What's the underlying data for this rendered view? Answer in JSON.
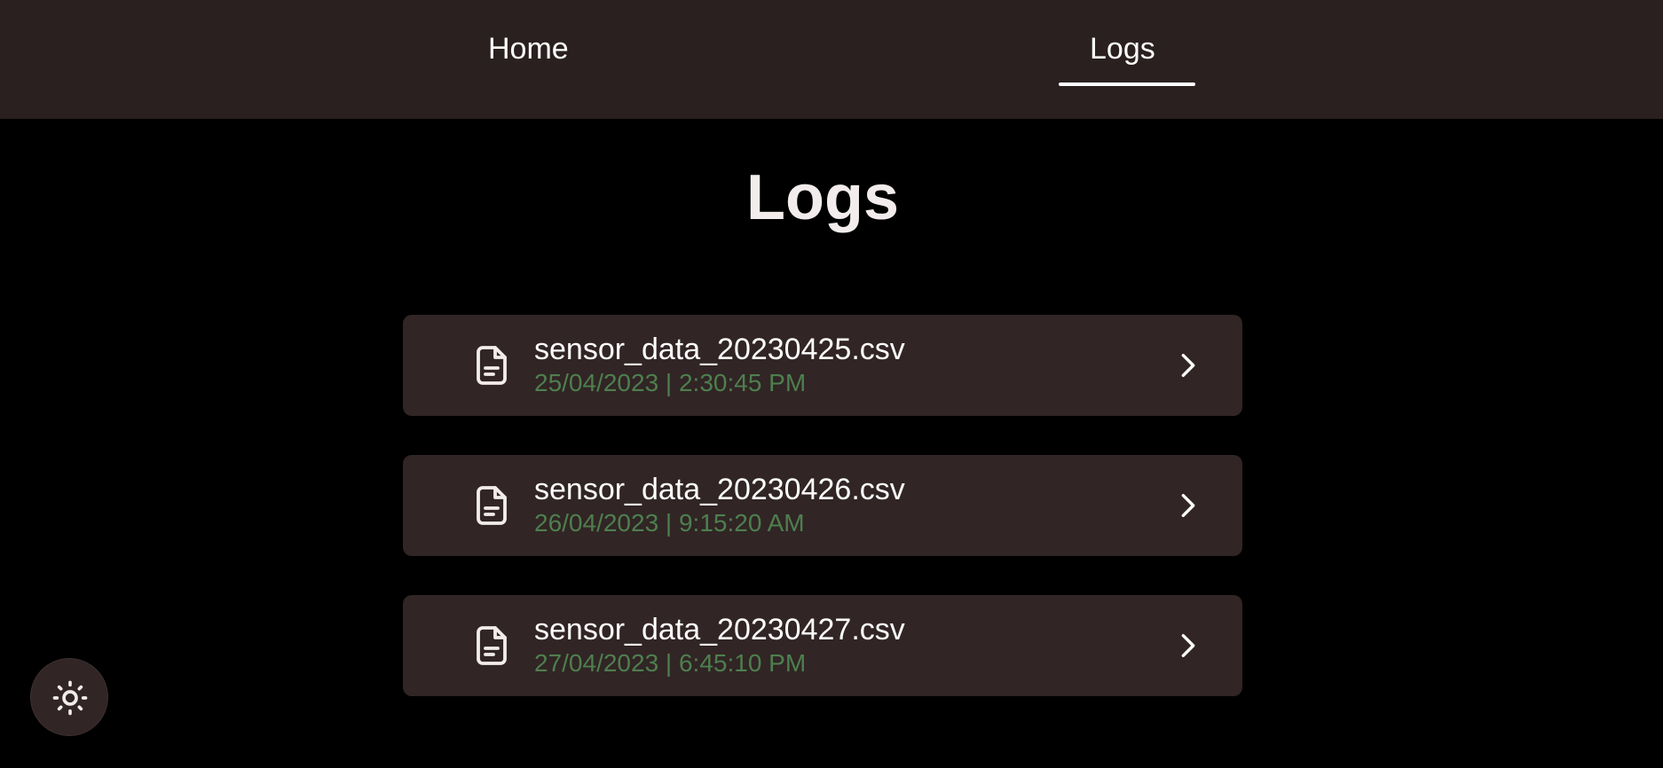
{
  "nav": {
    "items": [
      {
        "label": "Home",
        "active": false
      },
      {
        "label": "Logs",
        "active": true
      }
    ]
  },
  "page": {
    "title": "Logs"
  },
  "logs": [
    {
      "name": "sensor_data_20230425.csv",
      "timestamp": "25/04/2023 | 2:30:45 PM",
      "icon": "file-text-icon"
    },
    {
      "name": "sensor_data_20230426.csv",
      "timestamp": "26/04/2023 | 9:15:20 AM",
      "icon": "file-text-icon"
    },
    {
      "name": "sensor_data_20230427.csv",
      "timestamp": "27/04/2023 | 6:45:10 PM",
      "icon": "file-text-icon"
    }
  ],
  "theme_toggle": {
    "icon": "sun-icon"
  },
  "colors": {
    "nav_background": "#2a2020",
    "page_background": "#000000",
    "card_background": "#312525",
    "timestamp_text": "#4e7f4e",
    "primary_text": "#ffffff"
  }
}
